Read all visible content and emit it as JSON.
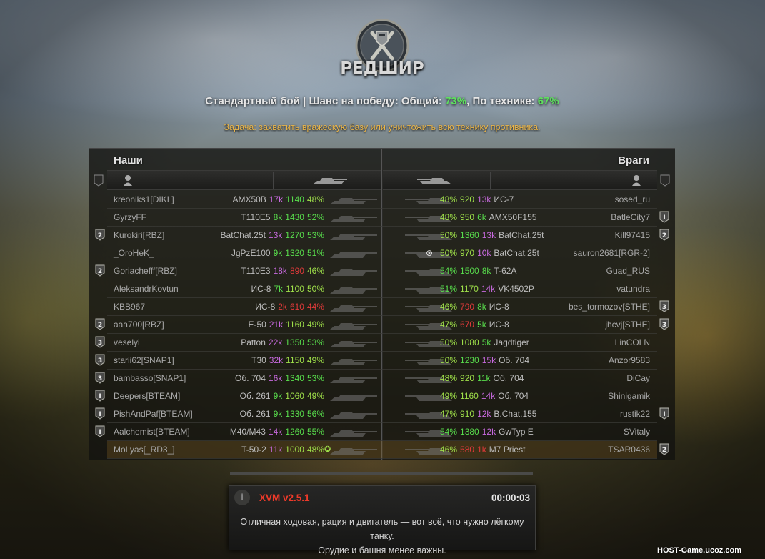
{
  "header": {
    "map_name": "РЕДШИР",
    "battle_type": "Стандартный бой",
    "separator": "|",
    "win_chance_label": "Шанс на победу: Общий:",
    "win_chance_overall": "73%",
    "by_tech_label": ", По технике:",
    "win_chance_tech": "67%",
    "task": "Задача: захватить вражескую базу или уничтожить всю технику противника."
  },
  "teams": {
    "allies_title": "Наши",
    "enemies_title": "Враги"
  },
  "colors": {
    "green": "#58dc4c",
    "light_green": "#9fe04a",
    "purple": "#c86adf",
    "red": "#e03a3a",
    "white": "#e6e6e6",
    "gray": "#9a9a9a",
    "task": "#e8b44a",
    "xvm_title": "#ee3a2a"
  },
  "allies": [
    {
      "player": "kreoniks1[DIKL]",
      "tank": "AMX50B",
      "battles": "17k",
      "bc": "purple",
      "rating": "1140",
      "rc": "green",
      "win": "48%",
      "wc": "light_green",
      "badge": ""
    },
    {
      "player": "GyrzyFF",
      "tank": "T110E5",
      "battles": "8k",
      "bc": "green",
      "rating": "1430",
      "rc": "green",
      "win": "52%",
      "wc": "green",
      "badge": ""
    },
    {
      "player": "Kurokiri[RBZ]",
      "tank": "BatChat.25t",
      "battles": "13k",
      "bc": "purple",
      "rating": "1270",
      "rc": "green",
      "win": "53%",
      "wc": "green",
      "badge": "2"
    },
    {
      "player": "_OroHeK_",
      "tank": "JgPzE100",
      "battles": "9k",
      "bc": "green",
      "rating": "1320",
      "rc": "green",
      "win": "51%",
      "wc": "green",
      "badge": ""
    },
    {
      "player": "Goriachefff[RBZ]",
      "tank": "T110E3",
      "battles": "18k",
      "bc": "purple",
      "rating": "890",
      "rc": "red",
      "win": "46%",
      "wc": "light_green",
      "badge": "2"
    },
    {
      "player": "AleksandrKovtun",
      "tank": "ИС-8",
      "battles": "7k",
      "bc": "green",
      "rating": "1100",
      "rc": "light_green",
      "win": "50%",
      "wc": "light_green",
      "badge": ""
    },
    {
      "player": "KBB967",
      "tank": "ИС-8",
      "battles": "2k",
      "bc": "red",
      "rating": "610",
      "rc": "red",
      "win": "44%",
      "wc": "red",
      "badge": ""
    },
    {
      "player": "aaa700[RBZ]",
      "tank": "E-50",
      "battles": "21k",
      "bc": "purple",
      "rating": "1160",
      "rc": "light_green",
      "win": "49%",
      "wc": "light_green",
      "badge": "2"
    },
    {
      "player": "veselyi",
      "tank": "Patton",
      "battles": "22k",
      "bc": "purple",
      "rating": "1350",
      "rc": "green",
      "win": "53%",
      "wc": "green",
      "badge": "3"
    },
    {
      "player": "starii62[SNAP1]",
      "tank": "T30",
      "battles": "32k",
      "bc": "purple",
      "rating": "1150",
      "rc": "light_green",
      "win": "49%",
      "wc": "light_green",
      "badge": "3"
    },
    {
      "player": "bambasso[SNAP1]",
      "tank": "Об. 704",
      "battles": "16k",
      "bc": "purple",
      "rating": "1340",
      "rc": "green",
      "win": "53%",
      "wc": "green",
      "badge": "3"
    },
    {
      "player": "Deepers[BTEAM]",
      "tank": "Об. 261",
      "battles": "9k",
      "bc": "green",
      "rating": "1060",
      "rc": "light_green",
      "win": "49%",
      "wc": "light_green",
      "badge": "1"
    },
    {
      "player": "PishAndPaf[BTEAM]",
      "tank": "Об. 261",
      "battles": "9k",
      "bc": "green",
      "rating": "1330",
      "rc": "green",
      "win": "56%",
      "wc": "green",
      "badge": "1"
    },
    {
      "player": "Aalchemist[BTEAM]",
      "tank": "M40/M43",
      "battles": "14k",
      "bc": "purple",
      "rating": "1260",
      "rc": "green",
      "win": "55%",
      "wc": "green",
      "badge": "1"
    },
    {
      "player": "MoLyas[_RD3_]",
      "tank": "T-50-2",
      "battles": "11k",
      "bc": "purple",
      "rating": "1000",
      "rc": "light_green",
      "win": "48%",
      "wc": "light_green",
      "badge": "",
      "highlight": true
    }
  ],
  "enemies": [
    {
      "player": "sosed_ru",
      "tank": "ИС-7",
      "battles": "13k",
      "bc": "purple",
      "rating": "920",
      "rc": "light_green",
      "win": "48%",
      "wc": "light_green",
      "badge": ""
    },
    {
      "player": "BatleCity7",
      "tank": "AMX50F155",
      "battles": "6k",
      "bc": "green",
      "rating": "950",
      "rc": "light_green",
      "win": "48%",
      "wc": "light_green",
      "badge": "1"
    },
    {
      "player": "Kill97415",
      "tank": "BatChat.25t",
      "battles": "13k",
      "bc": "purple",
      "rating": "1360",
      "rc": "green",
      "win": "50%",
      "wc": "light_green",
      "badge": "2"
    },
    {
      "player": "sauron2681[RGR-2]",
      "tank": "BatChat.25t",
      "battles": "10k",
      "bc": "purple",
      "rating": "970",
      "rc": "light_green",
      "win": "50%",
      "wc": "light_green",
      "badge": "",
      "mark": true
    },
    {
      "player": "Guad_RUS",
      "tank": "T-62A",
      "battles": "8k",
      "bc": "green",
      "rating": "1500",
      "rc": "green",
      "win": "54%",
      "wc": "green",
      "badge": ""
    },
    {
      "player": "vatundra",
      "tank": "VK4502P",
      "battles": "14k",
      "bc": "purple",
      "rating": "1170",
      "rc": "light_green",
      "win": "51%",
      "wc": "green",
      "badge": ""
    },
    {
      "player": "bes_tormozov[STHE]",
      "tank": "ИС-8",
      "battles": "8k",
      "bc": "green",
      "rating": "790",
      "rc": "red",
      "win": "46%",
      "wc": "light_green",
      "badge": "3"
    },
    {
      "player": "jhcvj[STHE]",
      "tank": "ИС-8",
      "battles": "5k",
      "bc": "green",
      "rating": "670",
      "rc": "red",
      "win": "47%",
      "wc": "light_green",
      "badge": "3"
    },
    {
      "player": "LinCOLN",
      "tank": "Jagdtiger",
      "battles": "5k",
      "bc": "green",
      "rating": "1080",
      "rc": "light_green",
      "win": "50%",
      "wc": "light_green",
      "badge": ""
    },
    {
      "player": "Anzor9583",
      "tank": "Об. 704",
      "battles": "15k",
      "bc": "purple",
      "rating": "1230",
      "rc": "green",
      "win": "50%",
      "wc": "light_green",
      "badge": ""
    },
    {
      "player": "DiCay",
      "tank": "Об. 704",
      "battles": "11k",
      "bc": "green",
      "rating": "920",
      "rc": "light_green",
      "win": "48%",
      "wc": "light_green",
      "badge": ""
    },
    {
      "player": "Shinigamik",
      "tank": "Об. 704",
      "battles": "14k",
      "bc": "purple",
      "rating": "1160",
      "rc": "light_green",
      "win": "49%",
      "wc": "light_green",
      "badge": ""
    },
    {
      "player": "rustik22",
      "tank": "B.Chat.155",
      "battles": "12k",
      "bc": "purple",
      "rating": "910",
      "rc": "light_green",
      "win": "47%",
      "wc": "light_green",
      "badge": "1"
    },
    {
      "player": "SVitaly",
      "tank": "GwTyp E",
      "battles": "12k",
      "bc": "purple",
      "rating": "1380",
      "rc": "green",
      "win": "54%",
      "wc": "green",
      "badge": ""
    },
    {
      "player": "TSAR0436",
      "tank": "M7 Priest",
      "battles": "1k",
      "bc": "red",
      "rating": "580",
      "rc": "red",
      "win": "46%",
      "wc": "light_green",
      "badge": "2"
    }
  ],
  "xvm": {
    "title": "XVM v2.5.1",
    "timer": "00:00:03",
    "tip_line1": "Отличная ходовая, рация и двигатель — вот всё, что нужно лёгкому танку.",
    "tip_line2": "Орудие и башня менее важны."
  },
  "watermark": "HOST-Game.ucoz.com"
}
